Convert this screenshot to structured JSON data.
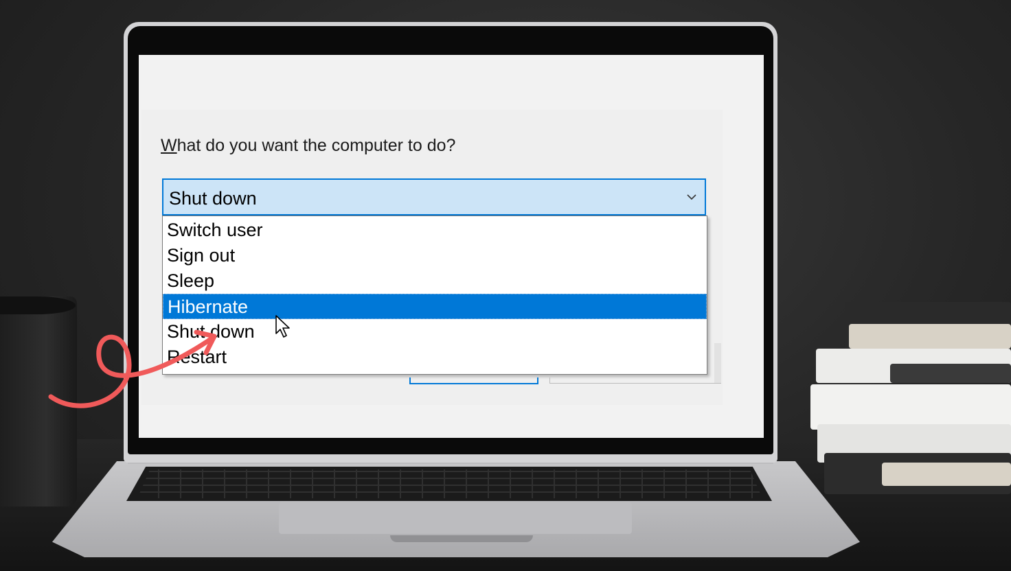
{
  "dialog": {
    "prompt": "What do you want the computer to do?",
    "prompt_underline_char": "W",
    "combo": {
      "selected_value": "Shut down",
      "expanded": true
    },
    "options": [
      {
        "label": "Switch user",
        "selected": false
      },
      {
        "label": "Sign out",
        "selected": false
      },
      {
        "label": "Sleep",
        "selected": false
      },
      {
        "label": "Hibernate",
        "selected": true
      },
      {
        "label": "Shut down",
        "selected": false
      },
      {
        "label": "Restart",
        "selected": false
      }
    ]
  },
  "colors": {
    "accent": "#0078d7",
    "combo_bg": "#cce4f7",
    "annotation_arrow": "#f05a5a"
  },
  "icons": {
    "combo": "chevron-down-icon",
    "pointer": "mouse-cursor-icon",
    "annotation": "curly-arrow-icon"
  }
}
